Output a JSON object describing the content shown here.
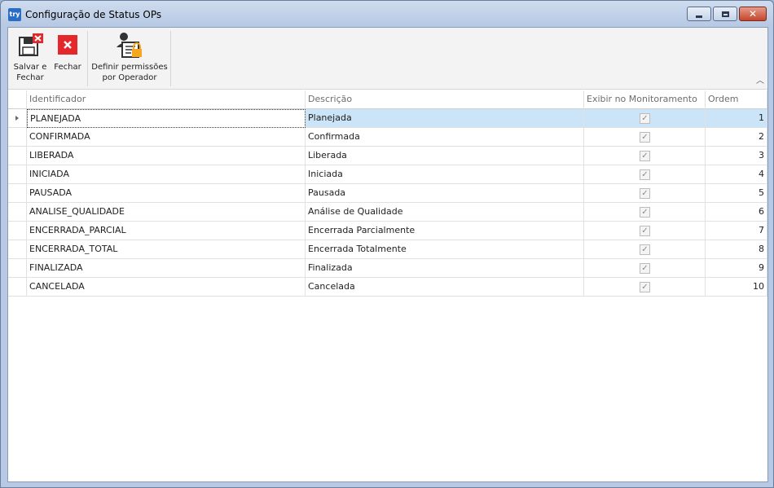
{
  "window": {
    "app_icon": "try",
    "title": "Configuração de Status OPs",
    "controls": {
      "minimize": "minimize-icon",
      "maximize": "maximize-icon",
      "close": "close-icon"
    }
  },
  "toolbar": {
    "save_line1": "Salvar e",
    "save_line2": "Fechar",
    "close_label": "Fechar",
    "perm_line1": "Definir permissões",
    "perm_line2": "por Operador",
    "icons": {
      "save": "save-close-icon",
      "close": "close-x-icon",
      "perm": "user-lock-icon",
      "collapse": "chevron-up-icon"
    },
    "colors": {
      "red": "#e5262b",
      "lock": "#f5a623"
    }
  },
  "grid": {
    "columns": [
      "Identificador",
      "Descrição",
      "Exibir no Monitoramento",
      "Ordem"
    ],
    "rows": [
      {
        "id": "PLANEJADA",
        "desc": "Planejada",
        "show": true,
        "order": "1"
      },
      {
        "id": "CONFIRMADA",
        "desc": "Confirmada",
        "show": true,
        "order": "2"
      },
      {
        "id": "LIBERADA",
        "desc": "Liberada",
        "show": true,
        "order": "3"
      },
      {
        "id": "INICIADA",
        "desc": "Iniciada",
        "show": true,
        "order": "4"
      },
      {
        "id": "PAUSADA",
        "desc": "Pausada",
        "show": true,
        "order": "5"
      },
      {
        "id": "ANALISE_QUALIDADE",
        "desc": "Análise de Qualidade",
        "show": true,
        "order": "6"
      },
      {
        "id": "ENCERRADA_PARCIAL",
        "desc": "Encerrada Parcialmente",
        "show": true,
        "order": "7"
      },
      {
        "id": "ENCERRADA_TOTAL",
        "desc": "Encerrada Totalmente",
        "show": true,
        "order": "8"
      },
      {
        "id": "FINALIZADA",
        "desc": "Finalizada",
        "show": true,
        "order": "9"
      },
      {
        "id": "CANCELADA",
        "desc": "Cancelada",
        "show": true,
        "order": "10"
      }
    ],
    "selected_row": 0,
    "selection_color": "#cce4f7"
  }
}
